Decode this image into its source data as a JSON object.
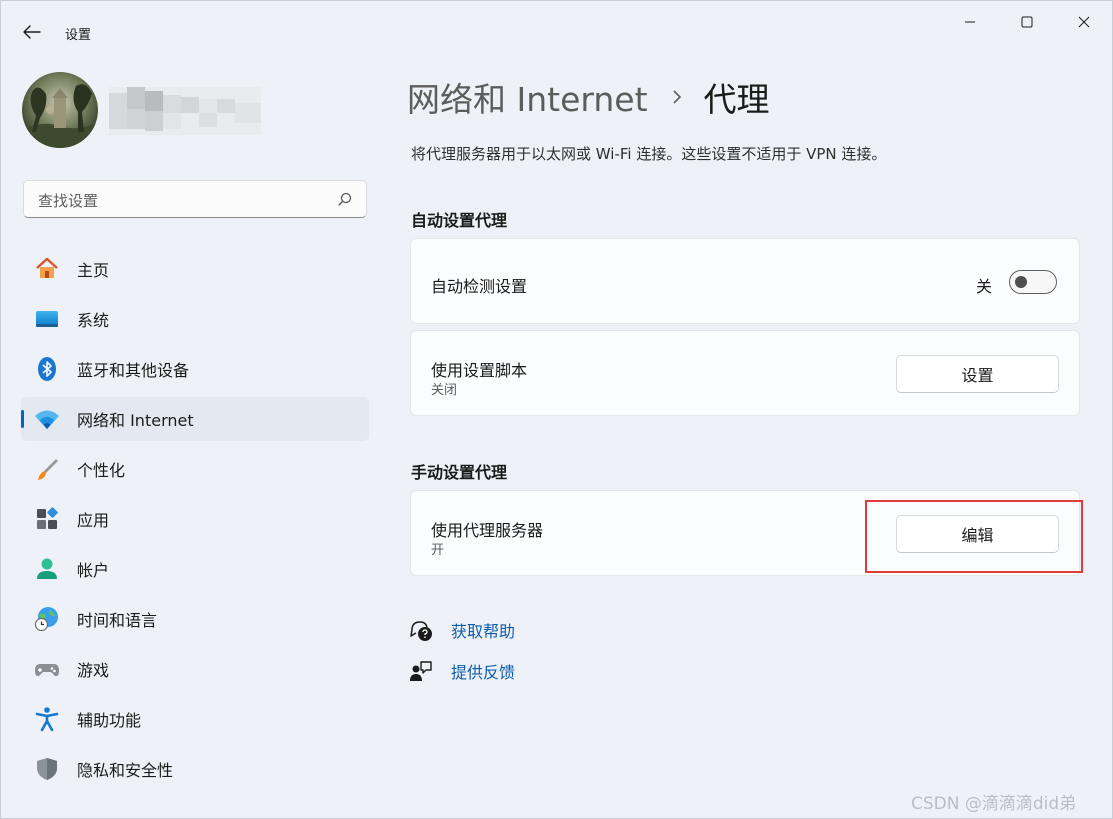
{
  "window": {
    "title": "设置"
  },
  "search": {
    "placeholder": "查找设置"
  },
  "nav": {
    "items": [
      {
        "label": "主页",
        "icon": "home-icon"
      },
      {
        "label": "系统",
        "icon": "monitor-icon"
      },
      {
        "label": "蓝牙和其他设备",
        "icon": "bluetooth-icon"
      },
      {
        "label": "网络和 Internet",
        "icon": "wifi-icon",
        "active": true
      },
      {
        "label": "个性化",
        "icon": "brush-icon"
      },
      {
        "label": "应用",
        "icon": "apps-icon"
      },
      {
        "label": "帐户",
        "icon": "account-icon"
      },
      {
        "label": "时间和语言",
        "icon": "globe-clock-icon"
      },
      {
        "label": "游戏",
        "icon": "gamepad-icon"
      },
      {
        "label": "辅助功能",
        "icon": "accessibility-icon"
      },
      {
        "label": "隐私和安全性",
        "icon": "shield-icon"
      }
    ]
  },
  "main": {
    "breadcrumb": {
      "parent": "网络和 Internet",
      "current": "代理"
    },
    "description": "将代理服务器用于以太网或 Wi-Fi 连接。这些设置不适用于 VPN 连接。",
    "auto_section": {
      "title": "自动设置代理",
      "detect": {
        "label": "自动检测设置",
        "state_label": "关",
        "enabled": false
      },
      "script": {
        "label": "使用设置脚本",
        "status": "关闭",
        "button": "设置"
      }
    },
    "manual_section": {
      "title": "手动设置代理",
      "proxy": {
        "label": "使用代理服务器",
        "status": "开",
        "button": "编辑"
      }
    },
    "links": {
      "help": "获取帮助",
      "feedback": "提供反馈"
    }
  },
  "watermark": "CSDN @滴滴滴did弟",
  "colors": {
    "accent": "#0067c0",
    "link": "#0b5cad",
    "highlight": "#e03c3c",
    "background": "#eef2f8"
  }
}
